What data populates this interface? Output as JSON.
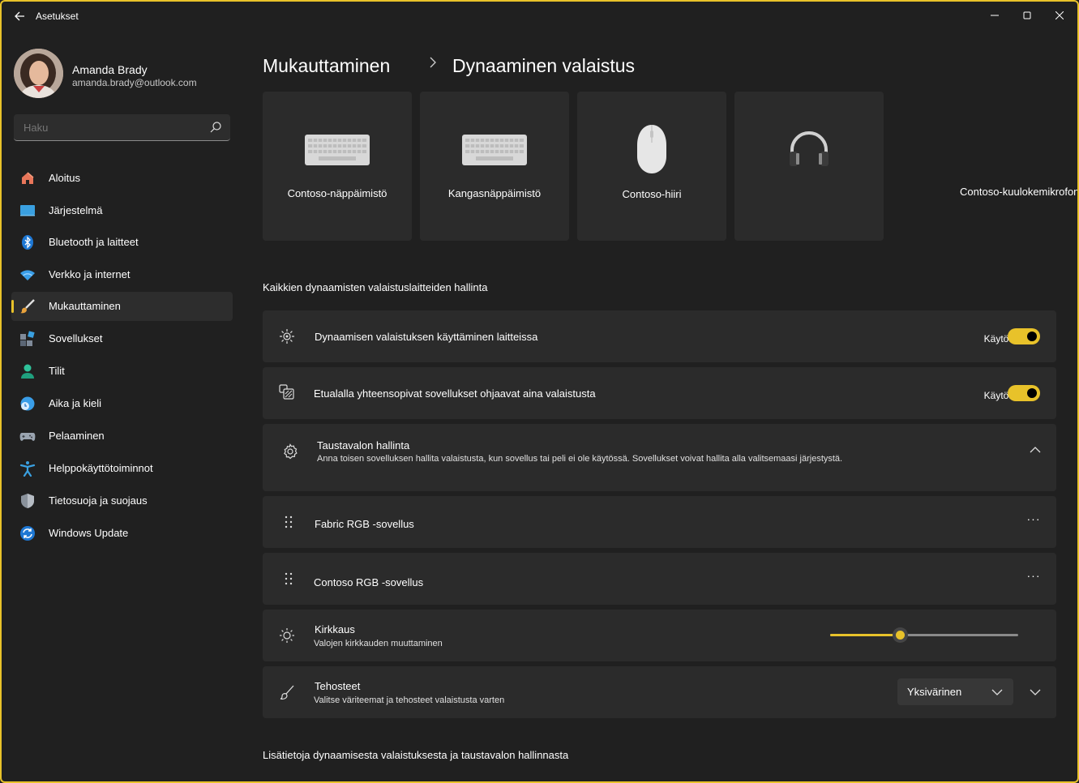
{
  "window": {
    "title": "Asetukset",
    "accent": "#e8c22a",
    "controls": [
      "minimize-icon",
      "maximize-icon",
      "close-icon"
    ]
  },
  "profile": {
    "name": "Amanda Brady",
    "email": "amanda.brady@outlook.com"
  },
  "search": {
    "placeholder": "Haku"
  },
  "sidebar": {
    "items": [
      {
        "label": "Aloitus",
        "icon": "home-icon"
      },
      {
        "label": "Järjestelmä",
        "icon": "system-icon"
      },
      {
        "label": "Bluetooth ja laitteet",
        "icon": "bluetooth-icon"
      },
      {
        "label": "Verkko ja internet",
        "icon": "wifi-icon"
      },
      {
        "label": "Mukauttaminen",
        "icon": "brush-icon",
        "active": true
      },
      {
        "label": "Sovellukset",
        "icon": "apps-icon"
      },
      {
        "label": "Tilit",
        "icon": "account-icon"
      },
      {
        "label": "Aika ja kieli",
        "icon": "time-language-icon"
      },
      {
        "label": "Pelaaminen",
        "icon": "gamepad-icon"
      },
      {
        "label": "Helppokäyttötoiminnot",
        "icon": "accessibility-icon"
      },
      {
        "label": "Tietosuoja ja suojaus",
        "icon": "shield-icon"
      },
      {
        "label": "Windows Update",
        "icon": "update-icon"
      }
    ]
  },
  "breadcrumb": {
    "parent": "Mukauttaminen",
    "current": "Dynaaminen valaistus"
  },
  "devices": [
    {
      "label": "Contoso-näppäimistö",
      "icon": "keyboard-icon"
    },
    {
      "label": "Kangasnäppäimistö",
      "icon": "keyboard-icon"
    },
    {
      "label": "Contoso-hiiri",
      "icon": "mouse-icon"
    },
    {
      "label": "Contoso-kuulokemikrofoni",
      "icon": "headset-icon"
    }
  ],
  "section_title": "Kaikkien dynaamisten valaistuslaitteiden hallinta",
  "settings": {
    "use_lighting": {
      "title": "Dynaamisen valaistuksen käyttäminen laitteissa",
      "state": "Käytössä",
      "on": true
    },
    "foreground_apps": {
      "title": "Etualalla yhteensopivat sovellukset ohjaavat aina valaistusta",
      "state": "Käytössä",
      "on": true
    },
    "background": {
      "title": "Taustavalon hallinta",
      "subtitle": "Anna toisen sovelluksen hallita valaistusta, kun sovellus tai peli ei ole käytössä. Sovellukset voivat hallita alla valitsemaasi järjestystä."
    },
    "apps": [
      {
        "title": "Fabric RGB -sovellus"
      },
      {
        "title": "Contoso RGB -sovellus"
      }
    ],
    "brightness": {
      "title": "Kirkkaus",
      "subtitle": "Valojen kirkkauden muuttaminen",
      "value_percent": 37
    },
    "effects": {
      "title": "Tehosteet",
      "subtitle": "Valitse väriteemat ja tehosteet valaistusta varten",
      "selected": "Yksivärinen"
    }
  },
  "more_label": "···",
  "footer_link": "Lisätietoja dynaamisesta valaistuksesta ja taustavalon hallinnasta"
}
